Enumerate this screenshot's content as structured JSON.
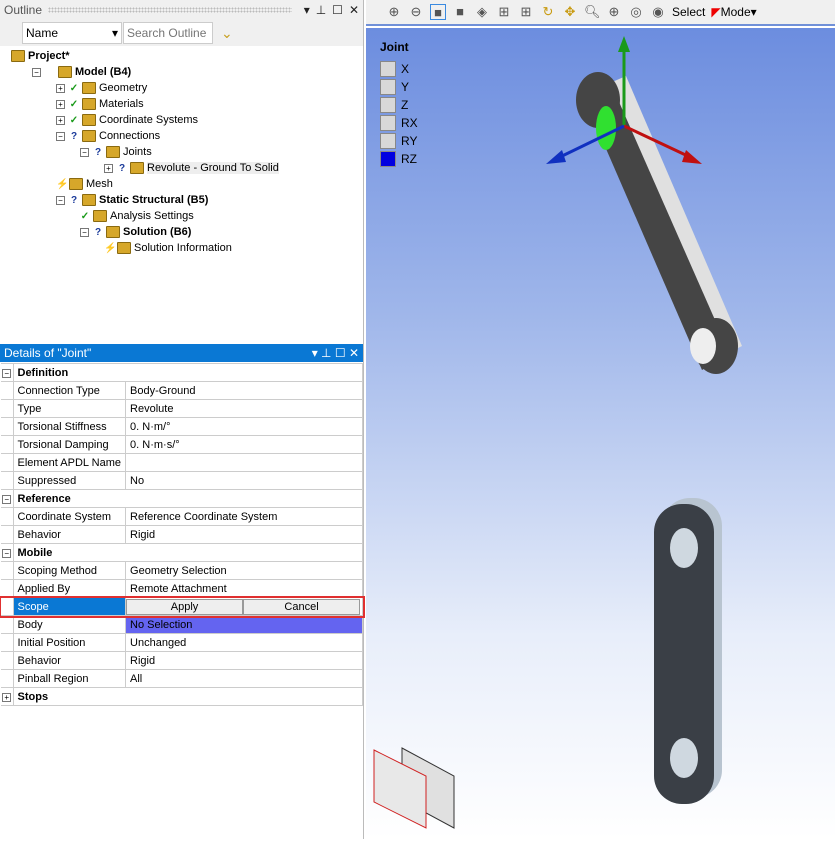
{
  "outline": {
    "title": "Outline",
    "filter": "Name",
    "search_placeholder": "Search Outline",
    "tree": [
      {
        "label": "Project*",
        "bold": true,
        "level": 0,
        "status": "",
        "exp": ""
      },
      {
        "label": "Model (B4)",
        "bold": true,
        "level": 1,
        "status": "",
        "exp": "-"
      },
      {
        "label": "Geometry",
        "level": 2,
        "status": "ok",
        "exp": "+"
      },
      {
        "label": "Materials",
        "level": 2,
        "status": "ok",
        "exp": "+"
      },
      {
        "label": "Coordinate Systems",
        "level": 2,
        "status": "ok",
        "exp": "+"
      },
      {
        "label": "Connections",
        "level": 2,
        "status": "q",
        "exp": "-"
      },
      {
        "label": "Joints",
        "level": 3,
        "status": "q",
        "exp": "-"
      },
      {
        "label": "Revolute - Ground To Solid",
        "level": 4,
        "status": "q",
        "exp": "+"
      },
      {
        "label": "Mesh",
        "level": 2,
        "status": "bolt",
        "exp": ""
      },
      {
        "label": "Static Structural (B5)",
        "bold": true,
        "level": 2,
        "status": "q",
        "exp": "-"
      },
      {
        "label": "Analysis Settings",
        "level": 3,
        "status": "ok",
        "exp": ""
      },
      {
        "label": "Solution (B6)",
        "bold": true,
        "level": 3,
        "status": "q",
        "exp": "-"
      },
      {
        "label": "Solution Information",
        "level": 4,
        "status": "bolt",
        "exp": ""
      }
    ]
  },
  "details": {
    "title": "Details of \"Joint\"",
    "rows": [
      {
        "cat": "Definition",
        "exp": "-"
      },
      {
        "k": "Connection Type",
        "v": "Body-Ground"
      },
      {
        "k": "Type",
        "v": "Revolute"
      },
      {
        "k": "Torsional Stiffness",
        "v": "0. N·m/°"
      },
      {
        "k": "Torsional Damping",
        "v": "0. N·m·s/°"
      },
      {
        "k": "Element APDL Name",
        "v": ""
      },
      {
        "k": "Suppressed",
        "v": "No"
      },
      {
        "cat": "Reference",
        "exp": "-"
      },
      {
        "k": "Coordinate System",
        "v": "Reference Coordinate System"
      },
      {
        "k": "Behavior",
        "v": "Rigid"
      },
      {
        "cat": "Mobile",
        "exp": "-"
      },
      {
        "k": "Scoping Method",
        "v": "Geometry Selection"
      },
      {
        "k": "Applied By",
        "v": "Remote Attachment"
      },
      {
        "k": "Scope",
        "scope": true
      },
      {
        "k": "Body",
        "v": "No Selection",
        "nosel": true
      },
      {
        "k": "Initial Position",
        "v": "Unchanged"
      },
      {
        "k": "Behavior",
        "v": "Rigid"
      },
      {
        "k": "Pinball Region",
        "v": "All"
      },
      {
        "cat": "Stops",
        "exp": "+"
      }
    ],
    "apply": "Apply",
    "cancel": "Cancel"
  },
  "viewport": {
    "select": "Select",
    "mode": "Mode",
    "dof_title": "Joint",
    "dofs": [
      {
        "l": "X",
        "free": false
      },
      {
        "l": "Y",
        "free": false
      },
      {
        "l": "Z",
        "free": false
      },
      {
        "l": "RX",
        "free": false
      },
      {
        "l": "RY",
        "free": false
      },
      {
        "l": "RZ",
        "free": true
      }
    ]
  }
}
